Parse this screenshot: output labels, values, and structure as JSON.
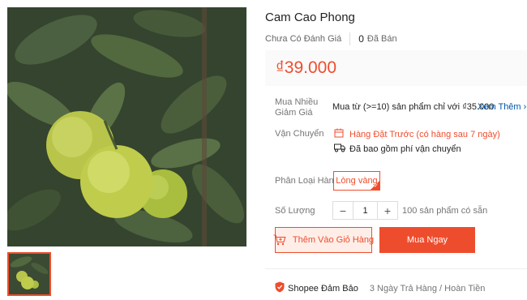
{
  "product": {
    "title": "Cam Cao Phong",
    "rating_text": "Chưa Có Đánh Giá",
    "sold_count": "0",
    "sold_label": "Đã Bán",
    "price": "₫39.000"
  },
  "bulk": {
    "label": "Mua Nhiều Giảm Giá",
    "text": "Mua từ (>=10) sản phẩm chỉ với ₫35.000",
    "see_more": "Xem Thêm",
    "see_more_icon": "chevron-right-icon"
  },
  "shipping": {
    "label": "Vận Chuyển",
    "preorder_text": "Hàng Đặt Trước (có hàng sau 7 ngày)",
    "preorder_icon": "calendar-icon",
    "fee_text": "Đã bao gồm phí vận chuyển",
    "fee_icon": "truck-icon"
  },
  "variant": {
    "label": "Phân Loại Hàng",
    "option": "Lòng vàng",
    "selected": true
  },
  "quantity": {
    "label": "Số Lượng",
    "minus": "−",
    "value": "1",
    "plus": "+",
    "stock": "100 sản phẩm có sẵn"
  },
  "actions": {
    "add_to_cart": "Thêm Vào Giỏ Hàng",
    "buy_now": "Mua Ngay",
    "cart_icon": "cart-plus-icon"
  },
  "guarantee": {
    "title": "Shopee Đảm Bảo",
    "text": "3 Ngày Trả Hàng / Hoàn Tiền",
    "icon": "shield-icon"
  },
  "colors": {
    "accent": "#ee4d2d",
    "link": "#0055aa",
    "price_bg": "#fafafa",
    "cart_bg": "#ffeee8"
  }
}
